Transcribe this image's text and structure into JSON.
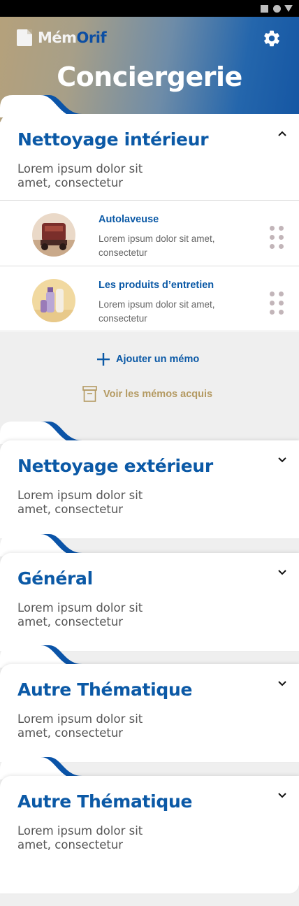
{
  "app": {
    "logo_part1": "Mém",
    "logo_part2": "Orif",
    "page_title": "Conciergerie",
    "colors": {
      "primary": "#0b59a6",
      "accent_gold": "#b49a62",
      "background": "#efefef"
    }
  },
  "icons": {
    "settings": "gear-icon",
    "expand": "chevron-up-icon",
    "collapse": "chevron-down-icon",
    "drag": "drag-handle-icon",
    "add": "plus-icon",
    "archive": "archive-box-icon",
    "logo": "document-icon"
  },
  "sections": [
    {
      "title": "Nettoyage intérieur",
      "desc": "Lorem ipsum dolor sit amet, consectetur",
      "expanded": true
    },
    {
      "title": "Nettoyage extérieur",
      "desc": "Lorem ipsum dolor sit amet, consectetur",
      "expanded": false
    },
    {
      "title": "Général",
      "desc": "Lorem ipsum dolor sit amet, consectetur",
      "expanded": false
    },
    {
      "title": "Autre Thématique",
      "desc": "Lorem ipsum dolor sit amet, consectetur",
      "expanded": false
    },
    {
      "title": "Autre Thématique",
      "desc": "Lorem ipsum dolor sit amet, consectetur",
      "expanded": false
    }
  ],
  "memos": [
    {
      "title": "Autolaveuse",
      "desc": "Lorem ipsum dolor sit amet, consectetur"
    },
    {
      "title": "Les produits d’entretien",
      "desc": "Lorem ipsum dolor sit amet, consectetur"
    }
  ],
  "actions": {
    "add_memo": "Ajouter un mémo",
    "view_acquired": "Voir les mémos acquis"
  }
}
